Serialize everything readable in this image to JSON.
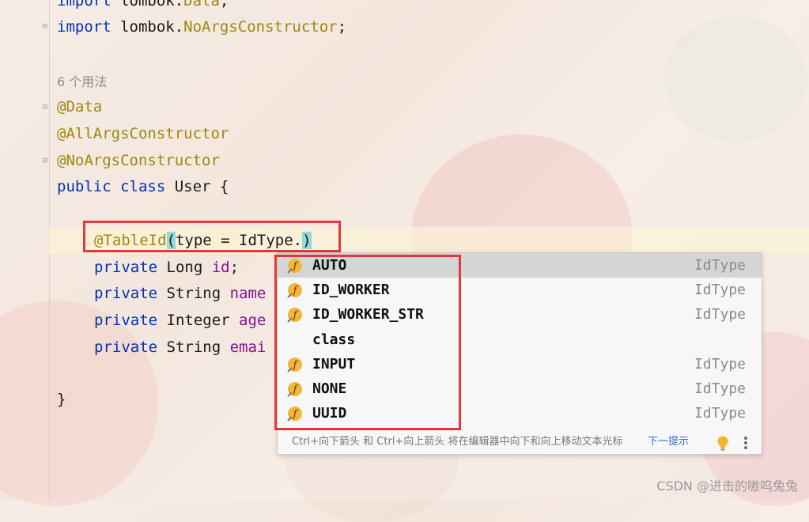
{
  "editor": {
    "lines": {
      "import_data_kw": "import",
      "import_data_pkg": " lombok.",
      "import_data_cls": "Data",
      "import_data_end": ";",
      "import_noargs_kw": "import",
      "import_noargs_pkg": " lombok.",
      "import_noargs_cls": "NoArgsConstructor",
      "import_noargs_end": ";",
      "usages_hint": "6 个用法",
      "ann_data": "@Data",
      "ann_allargs": "@AllArgsConstructor",
      "ann_noargs": "@NoArgsConstructor",
      "class_public": "public",
      "class_class": " class",
      "class_name": " User {",
      "tableid_ann": "@TableId",
      "tableid_open": "(",
      "tableid_args": "type = IdType.",
      "tableid_close": ")",
      "f1_kw": "private",
      "f1_type": " Long ",
      "f1_name": "id",
      "f1_end": ";",
      "f2_kw": "private",
      "f2_type": " String ",
      "f2_name": "name",
      "f3_kw": "private",
      "f3_type": " Integer ",
      "f3_name": "age",
      "f4_kw": "private",
      "f4_type": " String ",
      "f4_name": "emai",
      "close_brace": "}"
    }
  },
  "completion": {
    "items": [
      {
        "name": "AUTO",
        "type": "IdType",
        "icon": "field-f-icon",
        "selected": true
      },
      {
        "name": "ID_WORKER",
        "type": "IdType",
        "icon": "field-f-icon"
      },
      {
        "name": "ID_WORKER_STR",
        "type": "IdType",
        "icon": "field-f-icon"
      },
      {
        "name": "class",
        "type": "",
        "icon": ""
      },
      {
        "name": "INPUT",
        "type": "IdType",
        "icon": "field-f-icon"
      },
      {
        "name": "NONE",
        "type": "IdType",
        "icon": "field-f-icon"
      },
      {
        "name": "UUID",
        "type": "IdType",
        "icon": "field-f-icon"
      }
    ],
    "footer_text": "Ctrl+向下箭头 和 Ctrl+向上箭头 将在编辑器中向下和向上移动文本光标",
    "footer_link": "下一提示"
  },
  "watermark": "CSDN @进击的嗷呜兔兔",
  "colors": {
    "highlight_box": "#e03a3a",
    "keyword": "#0033b3",
    "annotation": "#9e880d",
    "field": "#871094"
  }
}
